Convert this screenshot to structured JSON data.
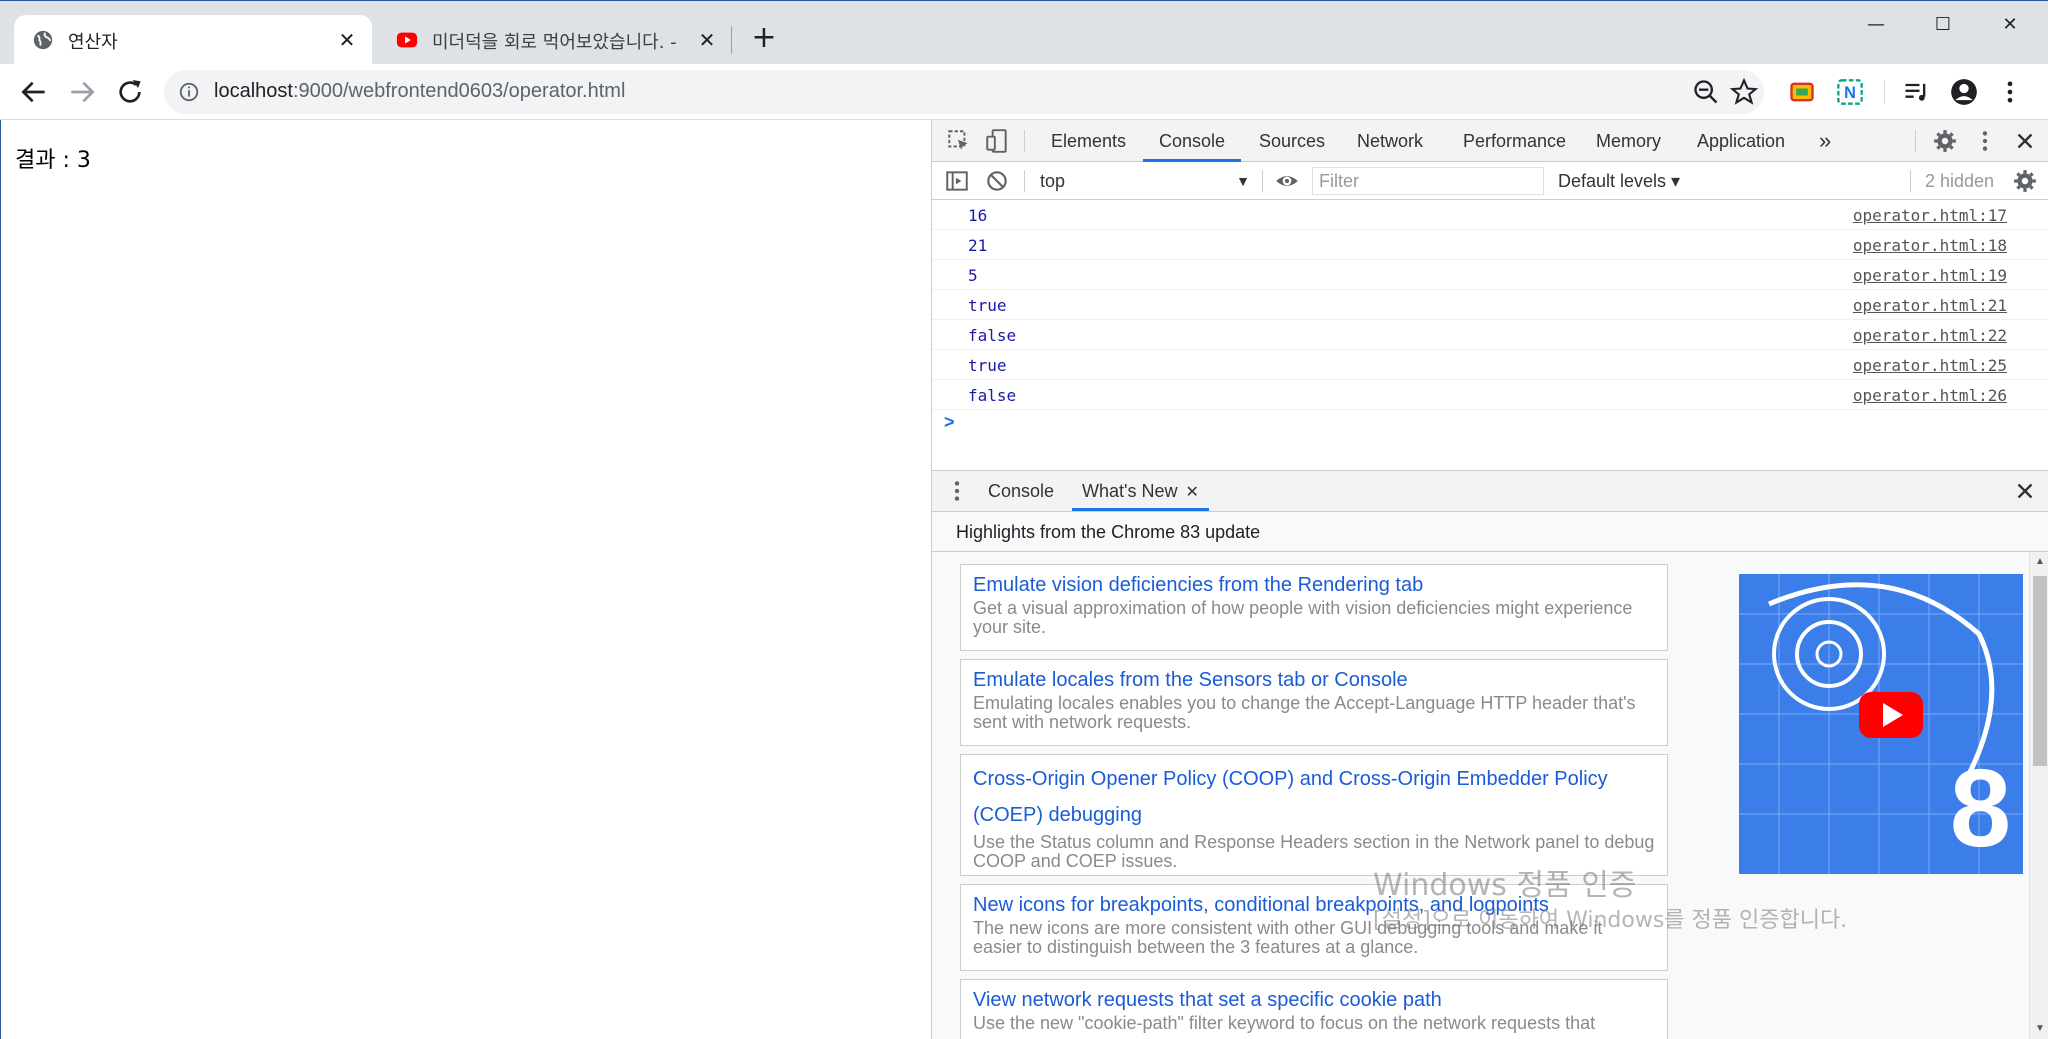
{
  "browser": {
    "tabs": [
      {
        "title": "연산자",
        "active": true
      },
      {
        "title": "미더덕을 회로 먹어보았습니다. -",
        "active": false
      }
    ],
    "close_glyph": "✕",
    "new_tab_glyph": "+",
    "window_controls": {
      "minimize": "—",
      "maximize": "☐",
      "close": "✕"
    },
    "url_host": "localhost",
    "url_rest": ":9000/webfrontend0603/operator.html"
  },
  "page": {
    "result_text": "결과 : 3"
  },
  "devtools": {
    "tabs": [
      "Elements",
      "Console",
      "Sources",
      "Network",
      "Performance",
      "Memory",
      "Application"
    ],
    "active_tab": "Console",
    "more_glyph": "»",
    "console_toolbar": {
      "context": "top",
      "filter_placeholder": "Filter",
      "levels": "Default levels ▾",
      "hidden": "2 hidden"
    },
    "log": [
      {
        "value": "16",
        "type": "num",
        "source": "operator.html:17"
      },
      {
        "value": "21",
        "type": "num",
        "source": "operator.html:18"
      },
      {
        "value": "5",
        "type": "num",
        "source": "operator.html:19"
      },
      {
        "value": "true",
        "type": "bool",
        "source": "operator.html:21"
      },
      {
        "value": "false",
        "type": "bool",
        "source": "operator.html:22"
      },
      {
        "value": "true",
        "type": "bool",
        "source": "operator.html:25"
      },
      {
        "value": "false",
        "type": "bool",
        "source": "operator.html:26"
      }
    ],
    "prompt": ">",
    "drawer": {
      "tabs": [
        "Console",
        "What's New"
      ],
      "active": "What's New",
      "tab_close": "✕"
    },
    "whats_new": {
      "header": "Highlights from the Chrome 83 update",
      "cards": [
        {
          "title": "Emulate vision deficiencies from the Rendering tab",
          "desc": "Get a visual approximation of how people with vision deficiencies might experience your site."
        },
        {
          "title": "Emulate locales from the Sensors tab or Console",
          "desc": "Emulating locales enables you to change the Accept-Language HTTP header that's sent with network requests."
        },
        {
          "title": "Cross-Origin Opener Policy (COOP) and Cross-Origin Embedder Policy (COEP) debugging",
          "desc": "Use the Status column and Response Headers section in the Network panel to debug COOP and COEP issues."
        },
        {
          "title": "New icons for breakpoints, conditional breakpoints, and logpoints",
          "desc": "The new icons are more consistent with other GUI debugging tools and make it easier to distinguish between the 3 features at a glance."
        },
        {
          "title": "View network requests that set a specific cookie path",
          "desc": "Use the new \"cookie-path\" filter keyword to focus on the network requests that"
        }
      ],
      "thumbnail_text": "8"
    }
  },
  "watermark": {
    "line1": "Windows 정품 인증",
    "line2": "[설정]으로 이동하여 Windows를 정품 인증합니다."
  },
  "colors": {
    "accent": "#1a73e8",
    "link": "#1a5bd8",
    "console_value": "#1a1aa6",
    "youtube_red": "#ff0000"
  }
}
